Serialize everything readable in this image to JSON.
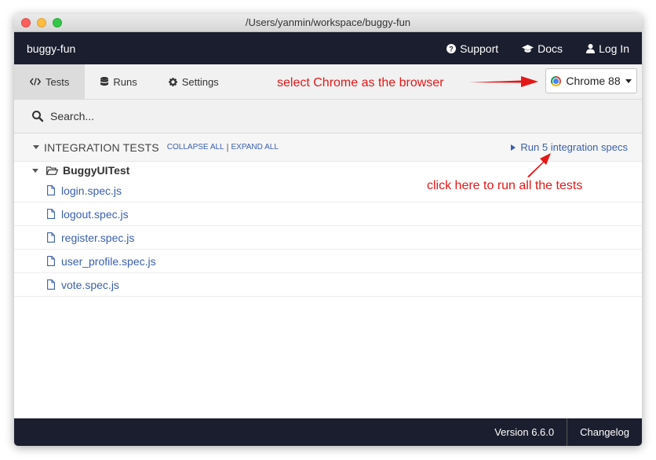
{
  "window": {
    "title": "/Users/yanmin/workspace/buggy-fun"
  },
  "header": {
    "brand": "buggy-fun",
    "support": "Support",
    "docs": "Docs",
    "login": "Log In"
  },
  "tabs": [
    {
      "label": "Tests",
      "icon": "code-icon",
      "active": true
    },
    {
      "label": "Runs",
      "icon": "database-icon",
      "active": false
    },
    {
      "label": "Settings",
      "icon": "gear-icon",
      "active": false
    }
  ],
  "browser": {
    "label": "Chrome 88"
  },
  "search": {
    "placeholder": "Search..."
  },
  "specs": {
    "section_title": "INTEGRATION TESTS",
    "collapse_all": "COLLAPSE ALL",
    "separator": "|",
    "expand_all": "EXPAND ALL",
    "run_all": "Run 5 integration specs",
    "folder": "BuggyUITest",
    "files": [
      "login.spec.js",
      "logout.spec.js",
      "register.spec.js",
      "user_profile.spec.js",
      "vote.spec.js"
    ]
  },
  "annotations": {
    "browser_hint": "select Chrome as the browser",
    "run_hint": "click here to run all the tests",
    "color": "#e51717"
  },
  "footer": {
    "version": "Version 6.6.0",
    "changelog": "Changelog"
  }
}
